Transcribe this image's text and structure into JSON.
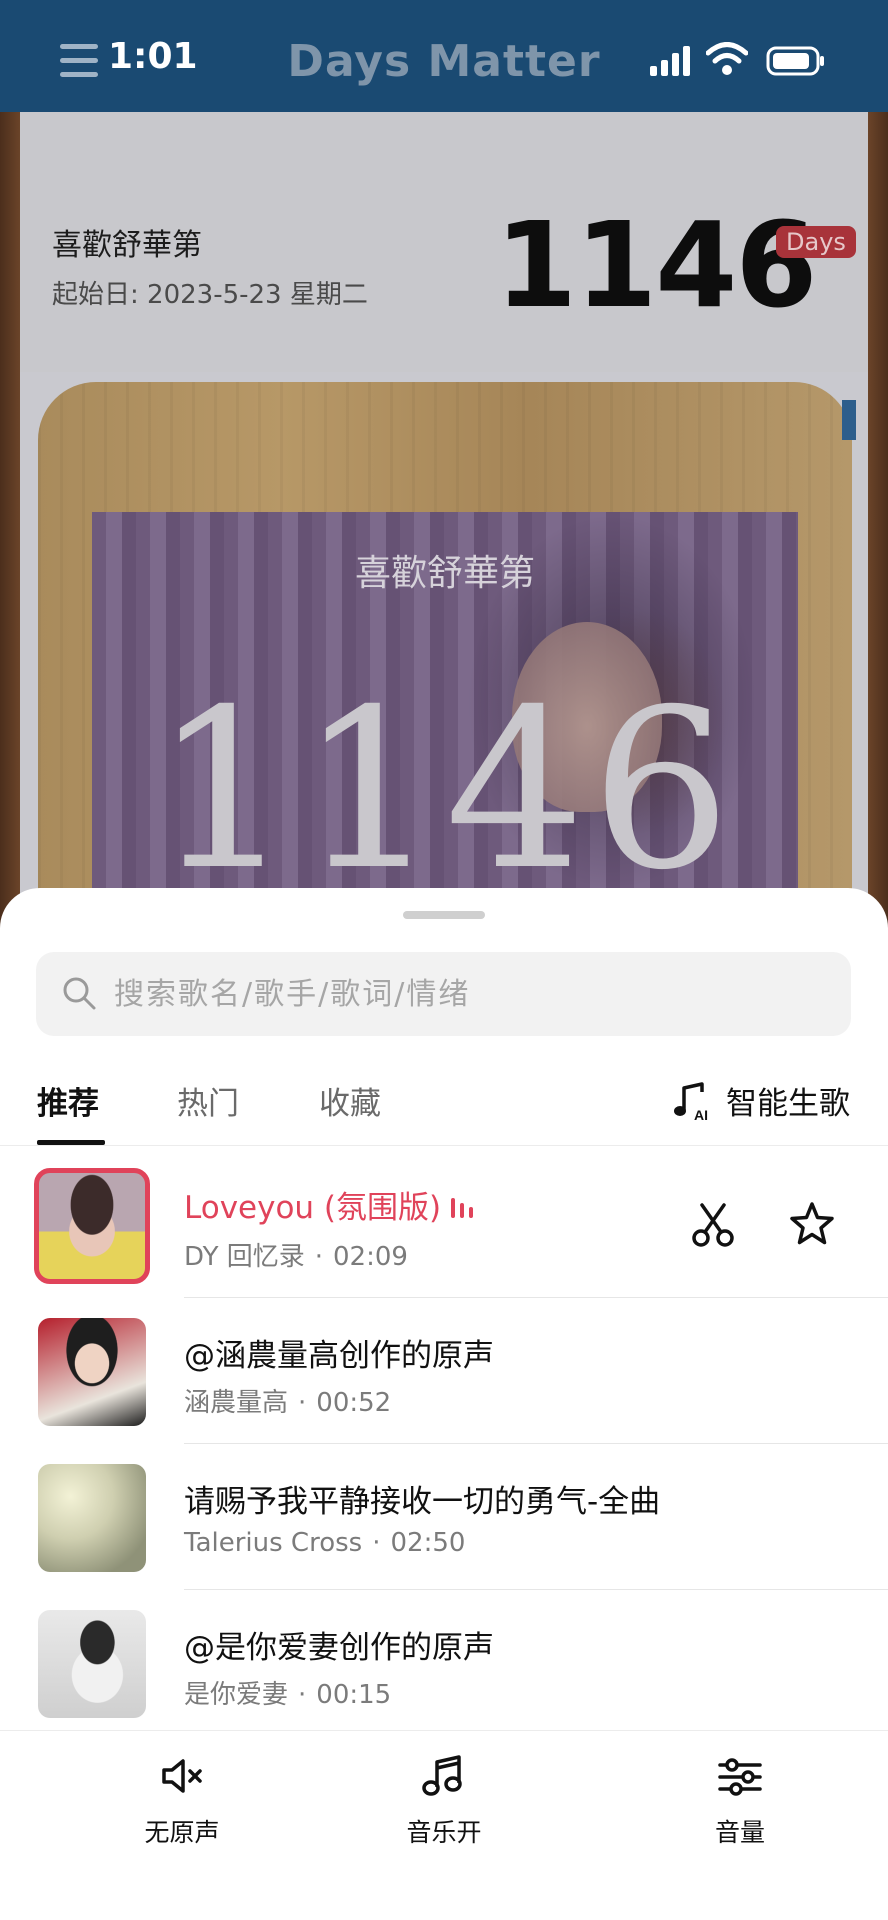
{
  "status_bar": {
    "time": "1:01"
  },
  "app": {
    "title": "Days Matter"
  },
  "event": {
    "name": "喜歡舒華第",
    "start_date": "起始日: 2023-5-23 星期二",
    "count": "1146",
    "unit_badge": "Days"
  },
  "photo_card": {
    "title": "喜歡舒華第",
    "count": "1146"
  },
  "music_sheet": {
    "search": {
      "placeholder": "搜索歌名/歌手/歌词/情绪",
      "value": ""
    },
    "tabs": [
      {
        "label": "推荐",
        "active": true
      },
      {
        "label": "热门",
        "active": false
      },
      {
        "label": "收藏",
        "active": false
      }
    ],
    "ai_song_label": "智能生歌",
    "songs": [
      {
        "title": "Loveyou (氛围版)",
        "artist": "DY 回忆录",
        "duration": "02:09",
        "playing": true
      },
      {
        "title": "@涵農量高创作的原声",
        "artist": "涵農量高",
        "duration": "00:52",
        "playing": false
      },
      {
        "title": "请赐予我平静接收一切的勇气-全曲",
        "artist": "Talerius Cross",
        "duration": "02:50",
        "playing": false
      },
      {
        "title": "@是你爱妻创作的原声",
        "artist": "是你爱妻",
        "duration": "00:15",
        "playing": false
      }
    ],
    "bottom_bar": {
      "mute_original": "无原声",
      "music_on": "音乐开",
      "volume": "音量"
    }
  },
  "colors": {
    "app_bar": "#1a4a72",
    "accent": "#e0435a",
    "badge": "#a8333a"
  }
}
